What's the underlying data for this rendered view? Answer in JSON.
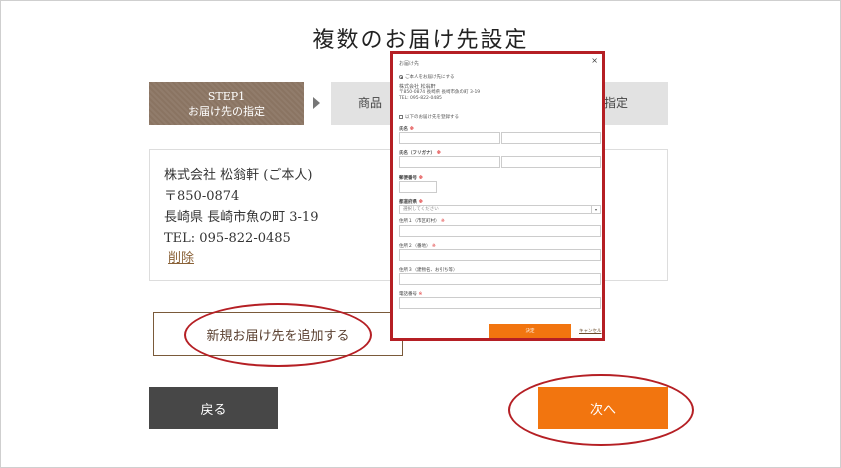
{
  "page": {
    "title": "複数のお届け先設定"
  },
  "steps": [
    {
      "line1": "STEP1",
      "line2": "お届け先の指定"
    },
    {
      "label": "商品"
    },
    {
      "label": "指定"
    }
  ],
  "address": {
    "name": "株式会社 松翁軒 (ご本人)",
    "postal": "〒850-0874",
    "street": "長崎県 長崎市魚の町 3-19",
    "tel": "TEL: 095-822-0485",
    "delete_label": "削除"
  },
  "buttons": {
    "add_label": "新規お届け先を追加する",
    "back_label": "戻る",
    "next_label": "次へ"
  },
  "modal": {
    "title": "お届け先",
    "close": "×",
    "radio_label": "ご本人をお届け先にする",
    "addr_name": "株式会社 松翁軒",
    "addr_line": "〒850-0874 長崎県 長崎市魚の町 3-19",
    "addr_tel": "TEL: 095-822-0485",
    "check_label": "以下のお届け先を登録する",
    "fields": {
      "name": "氏名",
      "kana": "氏名（フリガナ）",
      "postal": "郵便番号",
      "prefecture": "都道府県",
      "prefecture_placeholder": "選択してください",
      "address1": "住所１（市区町村）",
      "address2": "住所２（番地）",
      "address3": "住所３（建物名、お引ち等）",
      "phone": "電話番号",
      "req": "※"
    },
    "submit_label": "決定",
    "cancel_label": "キャンセル"
  }
}
